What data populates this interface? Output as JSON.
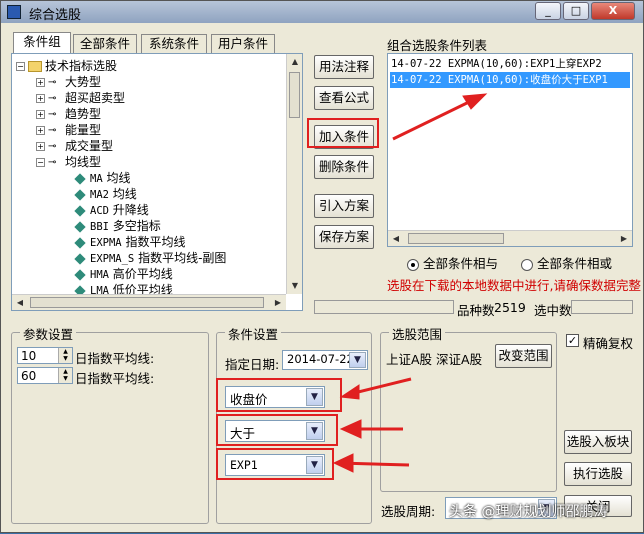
{
  "window": {
    "title": "综合选股",
    "controls": {
      "minimize": "_",
      "maximize": "□",
      "close": "X"
    }
  },
  "tabs": [
    {
      "label": "条件组"
    },
    {
      "label": "全部条件"
    },
    {
      "label": "系统条件"
    },
    {
      "label": "用户条件"
    }
  ],
  "tree": {
    "root": "技术指标选股",
    "categories": [
      "大势型",
      "超买超卖型",
      "趋势型",
      "能量型",
      "成交量型",
      "均线型"
    ],
    "indicators": [
      {
        "code": "MA",
        "name": "均线"
      },
      {
        "code": "MA2",
        "name": "均线"
      },
      {
        "code": "ACD",
        "name": "升降线"
      },
      {
        "code": "BBI",
        "name": "多空指标"
      },
      {
        "code": "EXPMA",
        "name": "指数平均线"
      },
      {
        "code": "EXPMA_S",
        "name": "指数平均线-副图"
      },
      {
        "code": "HMA",
        "name": "高价平均线"
      },
      {
        "code": "LMA",
        "name": "低价平均线"
      }
    ]
  },
  "actions": {
    "usage_notes": "用法注释",
    "view_formula": "查看公式",
    "add_condition": "加入条件",
    "delete_condition": "删除条件",
    "import_plan": "引入方案",
    "save_plan": "保存方案"
  },
  "condition_list": {
    "title": "组合选股条件列表",
    "items": [
      "14-07-22 EXPMA(10,60):EXP1上穿EXP2",
      "14-07-22 EXPMA(10,60):收盘价大于EXP1"
    ],
    "selected_index": 1
  },
  "logic": {
    "all_and": "全部条件相与",
    "all_or": "全部条件相或",
    "selected": "all_and"
  },
  "warning": "选股在下载的本地数据中进行,请确保数据完整",
  "stats": {
    "stock_count_label": "品种数",
    "stock_count_value": "2519",
    "selected_label": "选中数",
    "selected_value": ""
  },
  "params": {
    "title": "参数设置",
    "rows": [
      {
        "value": "10",
        "label": "日指数平均线:"
      },
      {
        "value": "60",
        "label": "日指数平均线:"
      }
    ]
  },
  "condition_settings": {
    "title": "条件设置",
    "date_label": "指定日期:",
    "date_value": "2014-07-22",
    "operand_left": "收盘价",
    "operator": "大于",
    "operand_right": "EXP1"
  },
  "range": {
    "title": "选股范围",
    "scope_text": "上证A股 深证A股",
    "change_button": "改变范围"
  },
  "options": {
    "precise_adjust_label": "精确复权",
    "precise_adjust_checked": true
  },
  "bottom": {
    "select_to_block": "选股入板块",
    "execute": "执行选股",
    "close_partial": "关闭",
    "period_label": "选股周期:",
    "period_value": ""
  },
  "watermark": "头条 @理财规划师邵鹏涛",
  "colors": {
    "highlight": "#3399ff",
    "annotation_red": "#e02020",
    "warning_text": "#d00000"
  }
}
